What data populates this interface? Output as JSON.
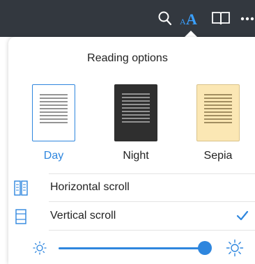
{
  "toolbar": {
    "icons": [
      "search-icon",
      "font-size-icon",
      "book-icon",
      "more-icon"
    ]
  },
  "panel": {
    "title": "Reading options",
    "themes": [
      {
        "label": "Day",
        "selected": true,
        "color": "#ffffff"
      },
      {
        "label": "Night",
        "selected": false,
        "color": "#2f2f2f"
      },
      {
        "label": "Sepia",
        "selected": false,
        "color": "#fbe7b4"
      }
    ],
    "scroll_options": [
      {
        "label": "Horizontal scroll",
        "icon": "horizontal-scroll-icon",
        "selected": false
      },
      {
        "label": "Vertical scroll",
        "icon": "vertical-scroll-icon",
        "selected": true
      }
    ],
    "brightness": {
      "level": 0.95
    }
  },
  "colors": {
    "accent": "#2e86de",
    "toolbar": "#33383f"
  }
}
